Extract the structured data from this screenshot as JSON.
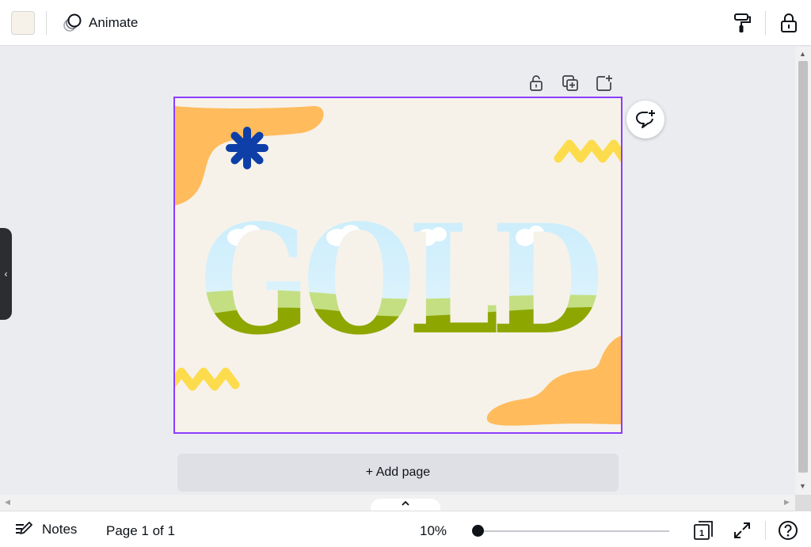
{
  "topbar": {
    "swatch_color": "#f6f2ea",
    "animate_label": "Animate",
    "icons": [
      "animate-icon",
      "paint-roller-icon",
      "lock-icon"
    ]
  },
  "page_actions": {
    "icons": [
      "unlock-icon",
      "duplicate-icon",
      "add-page-icon"
    ]
  },
  "design": {
    "heading": "GOLD",
    "background": "#f6f2ea",
    "accent_orange": "#ffbb5c",
    "accent_yellow": "#fcdc4d",
    "accent_blue": "#0e3fa8",
    "selection_color": "#8b3dff"
  },
  "comment": {
    "icon": "add-comment-icon"
  },
  "add_page_label": "+ Add page",
  "bottombar": {
    "notes_label": "Notes",
    "page_count": "Page 1 of 1",
    "zoom": "10%",
    "zoom_fraction": 0.0,
    "page_badge": "1",
    "icons": [
      "notes-icon",
      "pages-icon",
      "fullscreen-icon",
      "help-icon"
    ]
  }
}
